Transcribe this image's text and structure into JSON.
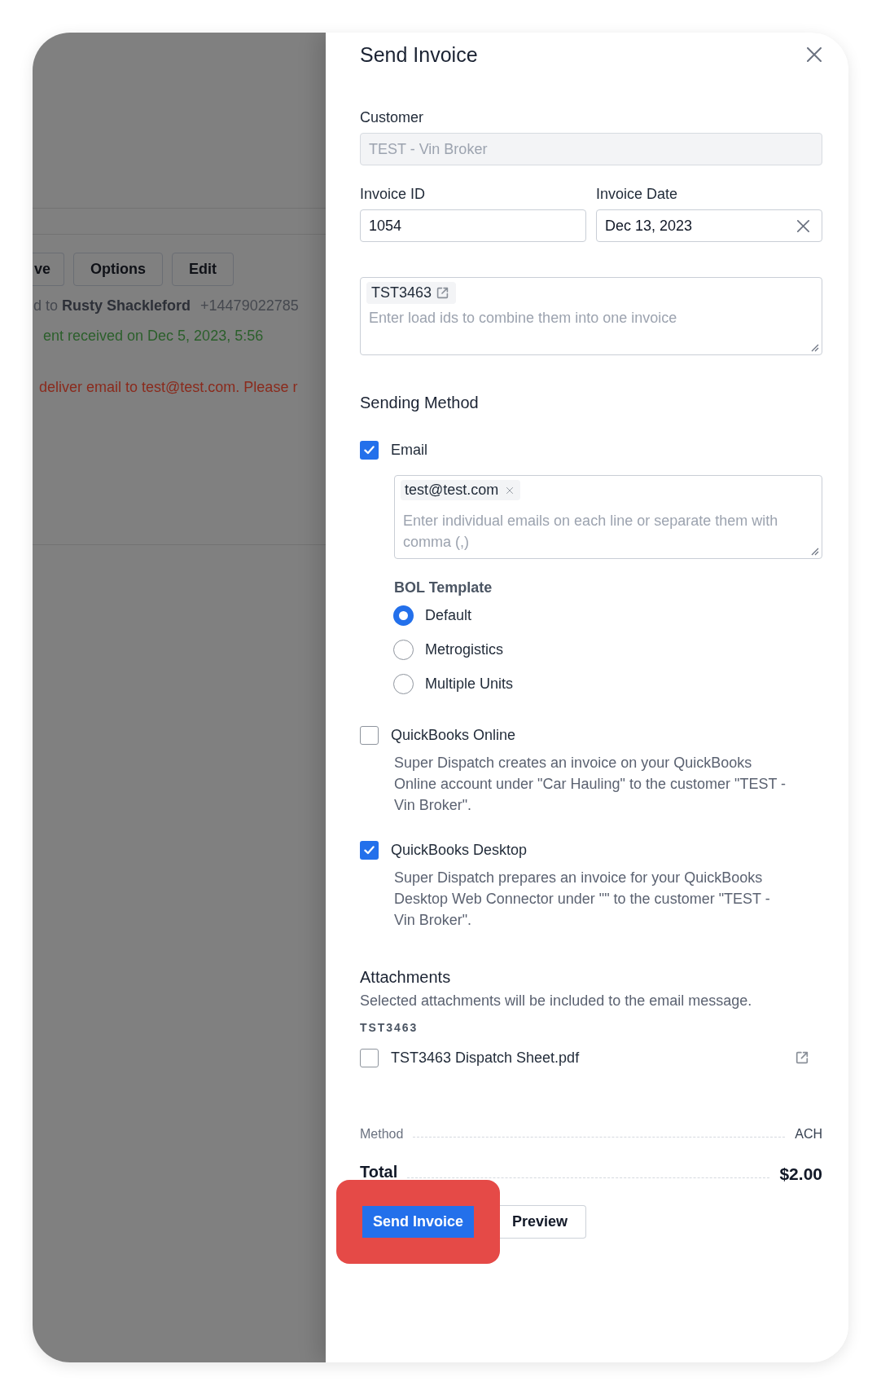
{
  "background": {
    "toolbar_buttons": [
      {
        "label": "ve"
      },
      {
        "label": "Options"
      },
      {
        "label": "Edit"
      }
    ],
    "driver_line": {
      "text": "d to **Rusty Shackleford**",
      "phone": "+14479022785"
    },
    "payment_status": "ent received on Dec 5, 2023, 5:56",
    "error_message": "deliver email to test@test.com. Please r"
  },
  "drawer": {
    "title": "Send Invoice",
    "customer": {
      "label": "Customer",
      "value": "TEST - Vin Broker",
      "disabled": true
    },
    "invoice_id": {
      "label": "Invoice ID",
      "value": "1054"
    },
    "invoice_date": {
      "label": "Invoice Date",
      "value": "Dec 13, 2023"
    },
    "load_ids": {
      "chips": [
        "TST3463"
      ],
      "placeholder": "Enter load ids to combine them into one invoice"
    },
    "sending_method": {
      "title": "Sending Method",
      "options": [
        {
          "kind": "email",
          "label": "Email",
          "checked": true,
          "recipients": [
            "test@test.com"
          ],
          "placeholder": "Enter individual emails on each line or separate them with comma (,)",
          "bol_template": {
            "label": "BOL Template",
            "options": [
              {
                "label": "Default",
                "selected": true
              },
              {
                "label": "Metrogistics",
                "selected": false
              },
              {
                "label": "Multiple Units",
                "selected": false
              }
            ]
          }
        },
        {
          "kind": "integration",
          "label": "QuickBooks Online",
          "checked": false,
          "description": "Super Dispatch creates an invoice on your QuickBooks Online account under \"Car Hauling\" to the customer \"TEST - Vin Broker\"."
        },
        {
          "kind": "integration",
          "label": "QuickBooks Desktop",
          "checked": true,
          "description": "Super Dispatch prepares an invoice for your QuickBooks Desktop Web Connector under \"\" to the customer \"TEST - Vin Broker\"."
        }
      ]
    },
    "attachments": {
      "title": "Attachments",
      "subtitle": "Selected attachments will be included to the email message.",
      "groups": [
        {
          "name": "TST3463",
          "files": [
            {
              "name": "TST3463 Dispatch Sheet.pdf",
              "checked": false
            }
          ]
        }
      ]
    },
    "summary": [
      {
        "kind": "detail",
        "label": "Method",
        "value": "ACH"
      },
      {
        "kind": "total",
        "label": "Total",
        "value": "$2.00"
      }
    ],
    "actions": [
      {
        "kind": "primary",
        "label": "Send Invoice",
        "highlighted": true
      },
      {
        "kind": "secondary",
        "label": "Preview",
        "highlighted": false
      }
    ]
  }
}
